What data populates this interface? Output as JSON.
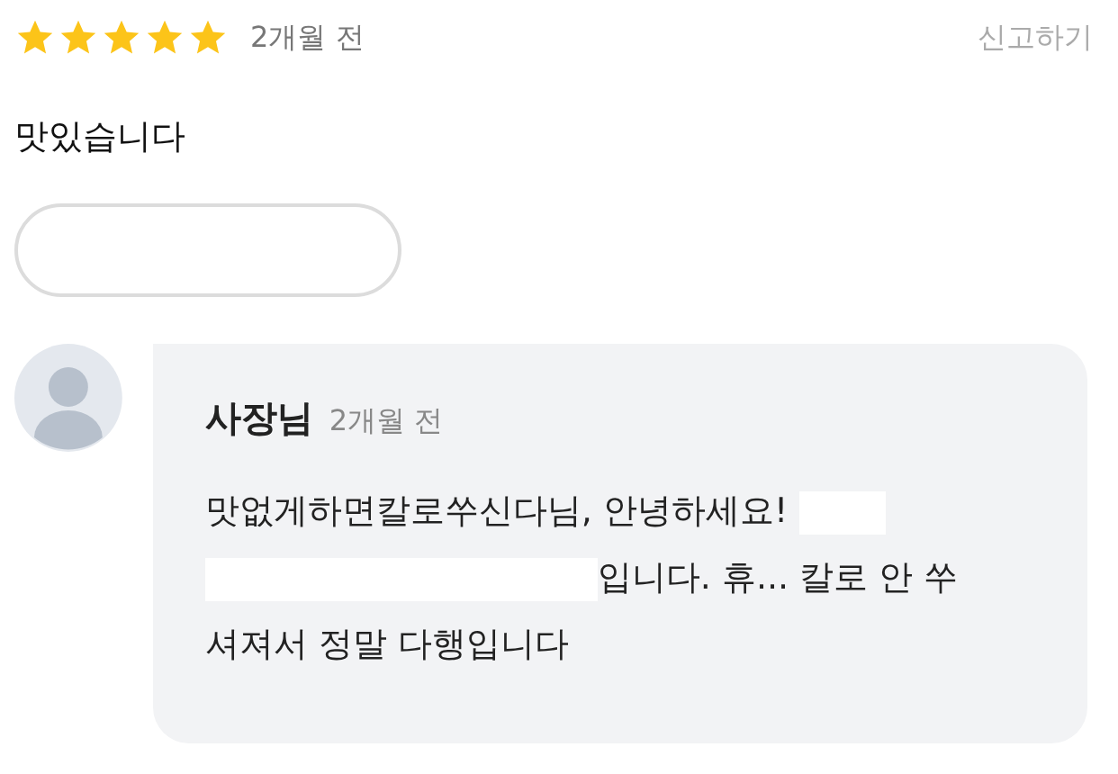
{
  "review": {
    "stars": 5,
    "date": "2개월 전",
    "report_link": "신고하기",
    "text": "맛있습니다"
  },
  "owner_reply": {
    "author": "사장님",
    "date": "2개월 전",
    "segments": [
      {
        "kind": "text",
        "text": "맛없게하면칼로쑤신다님,  안녕하세요! "
      },
      {
        "kind": "redacted"
      },
      {
        "kind": "redacted"
      },
      {
        "kind": "text",
        "text": "입니다. 휴... 칼로 안 쑤셔져서 정말 다행입니다"
      }
    ]
  }
}
